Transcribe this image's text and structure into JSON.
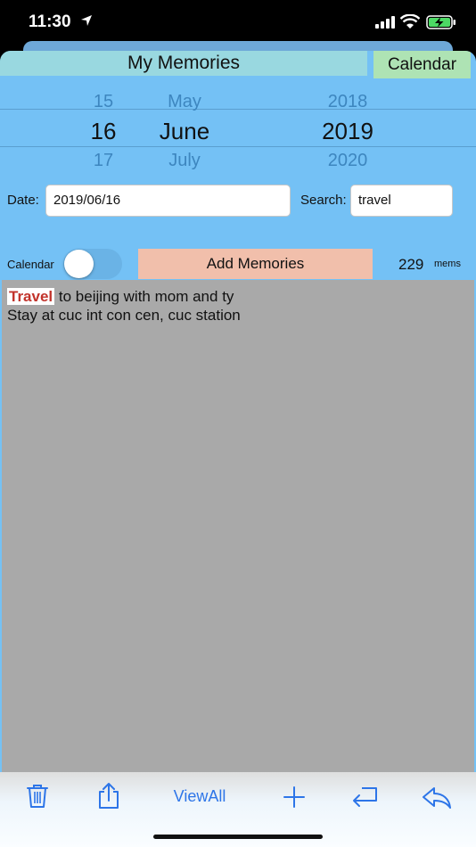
{
  "status": {
    "time": "11:30"
  },
  "header": {
    "title": "My Memories",
    "calendar_button": "Calendar"
  },
  "picker": {
    "days": [
      "15",
      "16",
      "17"
    ],
    "months": [
      "May",
      "June",
      "July"
    ],
    "years": [
      "2018",
      "2019",
      "2020"
    ]
  },
  "filters": {
    "date_label": "Date:",
    "date_value": "2019/06/16",
    "search_label": "Search:",
    "search_value": "travel"
  },
  "controls": {
    "calendar_toggle_label": "Calendar",
    "calendar_toggle_on": false,
    "add_button": "Add Memories",
    "count": "229",
    "count_unit": "mems"
  },
  "memo": {
    "highlight": "Travel",
    "line1_rest": " to beijing with mom and ty",
    "line2": "Stay at cuc int con cen, cuc station"
  },
  "toolbar": {
    "view_all": "ViewAll",
    "icons": [
      "trash-icon",
      "share-icon",
      "plus-icon",
      "return-icon",
      "reply-icon"
    ]
  },
  "colors": {
    "app_background": "#74c1f5",
    "title_background": "#99d8e0",
    "calendar_button_background": "#aee3b4",
    "add_button_background": "#f1bfab",
    "memo_background": "#a9a9a9",
    "highlight_text": "#c2332b",
    "toolbar_tint": "#2d75e8"
  }
}
